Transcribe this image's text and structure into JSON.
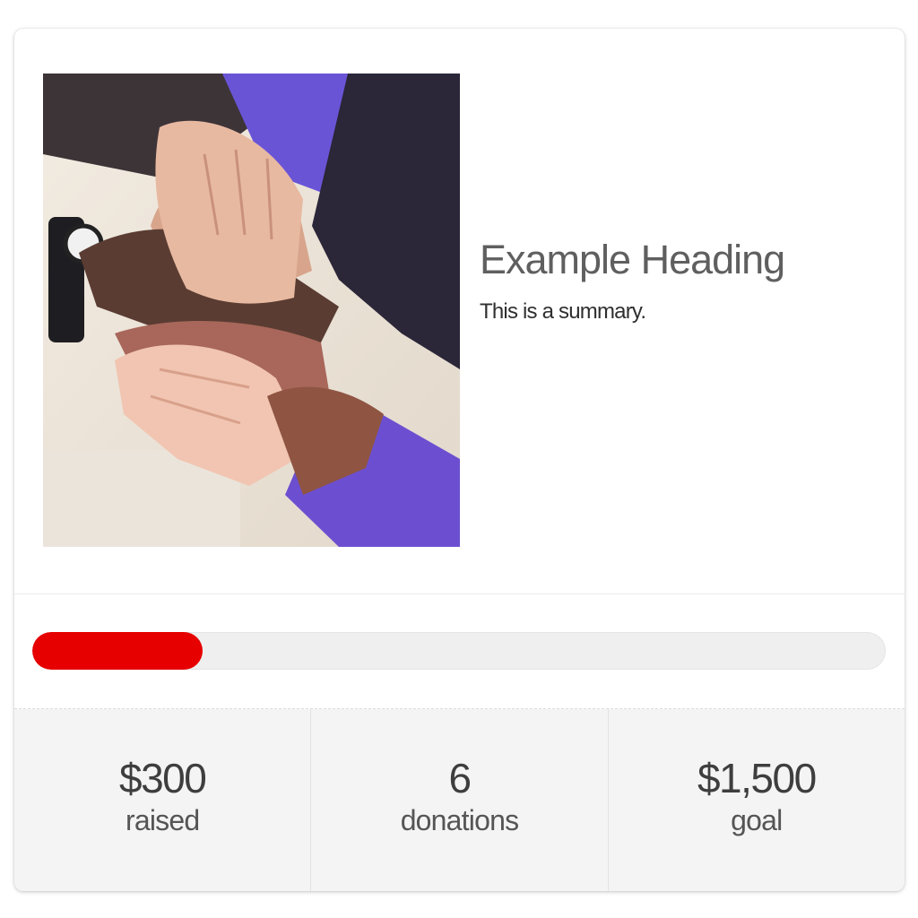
{
  "campaign": {
    "heading": "Example Heading",
    "summary": "This is a summary.",
    "image_icon": "stacked-hands-photo"
  },
  "progress": {
    "fraction": 0.2,
    "fill_color": "#e60000",
    "track_color": "#efefef"
  },
  "stats": [
    {
      "value": "$300",
      "label": "raised"
    },
    {
      "value": "6",
      "label": "donations"
    },
    {
      "value": "$1,500",
      "label": "goal"
    }
  ]
}
